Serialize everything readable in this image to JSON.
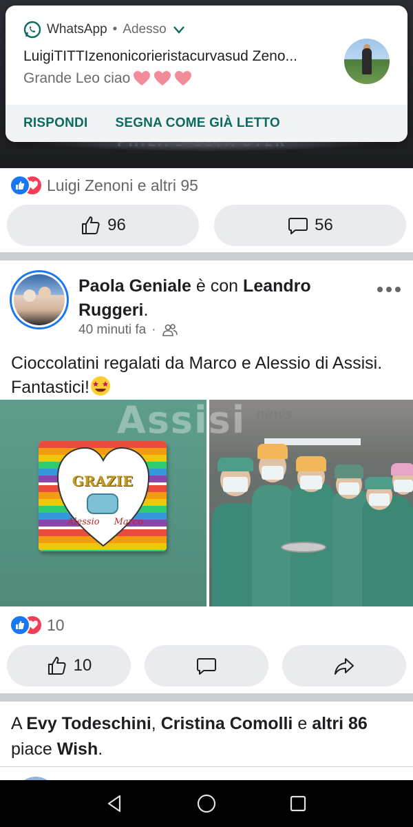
{
  "notification": {
    "app_name": "WhatsApp",
    "separator": "•",
    "time": "Adesso",
    "title": "LuigiTITTIzenonicorieristacurvasud Zeno...",
    "message": "Grande Leo ciao",
    "hearts": [
      "pink-heart",
      "pink-heart",
      "pink-heart"
    ],
    "actions": {
      "reply": "RISPONDI",
      "mark_read": "SEGNA COME GIÀ LETTO"
    }
  },
  "previous_post": {
    "reactions_text": "Luigi Zenoni e altri 95",
    "like_count": "96",
    "comment_count": "56"
  },
  "post": {
    "author": "Paola Geniale",
    "with_word": "è con",
    "tagged": "Leandro Ruggeri",
    "tagged_suffix": ".",
    "time": "40 minuti fa",
    "meta_dot": "·",
    "privacy_icon": "friends-icon",
    "text": "Cioccolatini regalati da Marco e Alessio di Assisi. Fantastici!",
    "emoji": "star-struck-emoji",
    "photo_left": {
      "card_text": "GRAZIE",
      "name1": "Alessio",
      "name2": "Marco"
    },
    "watermark": "Assisi",
    "watermark_news": "news",
    "reaction_count": "10",
    "like_count": "10"
  },
  "likes_line": {
    "prefix": "A",
    "name1": "Evy Todeschini",
    "comma": ",",
    "name2": "Cristina Comolli",
    "conj": "e",
    "others": "altri 86",
    "verb": "piace",
    "page": "Wish",
    "end": "."
  },
  "colors": {
    "facebook_blue": "#1877f2",
    "love_red": "#f33e58",
    "whatsapp_green": "#0b6b5e",
    "pill_bg": "#e9ebee"
  }
}
